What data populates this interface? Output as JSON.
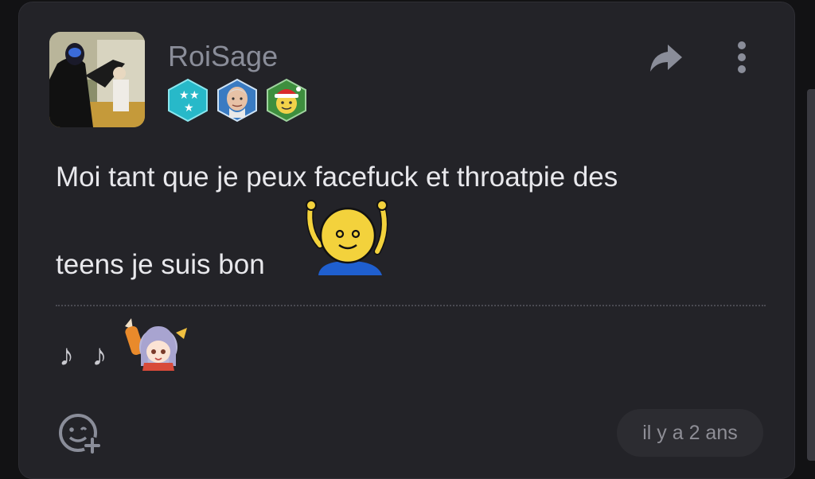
{
  "post": {
    "username": "RoiSage",
    "message_line1": "Moi tant que je peux facefuck et throatpie des",
    "message_line2": "teens je suis bon",
    "signature": "♪ ♪",
    "timestamp": "il y a 2 ans"
  },
  "icons": {
    "share": "share-arrow-icon",
    "more": "more-vertical-icon",
    "react": "add-reaction-icon"
  },
  "badges": [
    "stars-badge",
    "old-man-badge",
    "santa-smiley-badge"
  ],
  "colors": {
    "background": "#121214",
    "card": "#232328",
    "username": "#8a8d99",
    "text": "#e8e8ec",
    "muted": "#8e8e96"
  }
}
